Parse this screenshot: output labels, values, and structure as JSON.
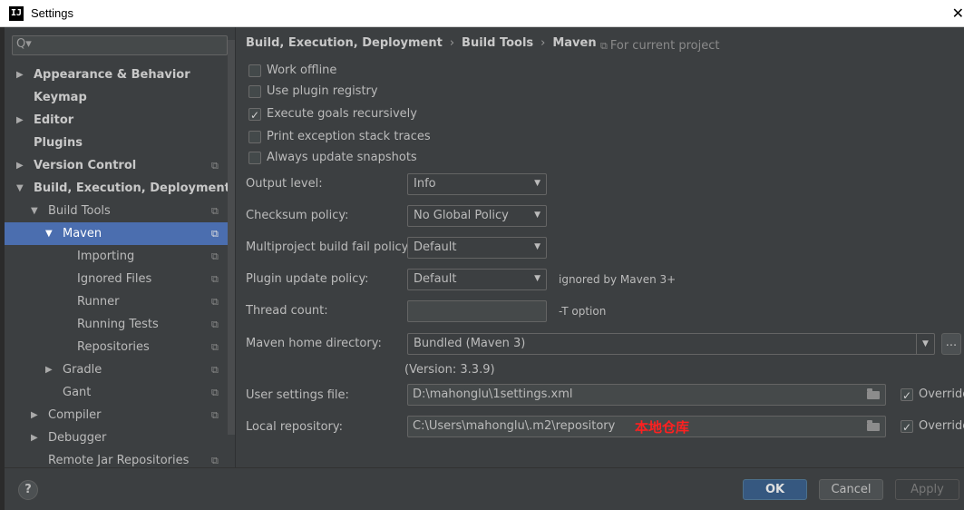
{
  "window": {
    "title": "Settings",
    "close_glyph": "✕",
    "app_icon_text": "IJ"
  },
  "search": {
    "icon": "Q▾",
    "placeholder": ""
  },
  "tree": [
    {
      "label": "Appearance & Behavior",
      "arrow": "▶",
      "bold": true,
      "project": false,
      "selected": false
    },
    {
      "label": "Keymap",
      "arrow": "",
      "bold": true,
      "project": false,
      "selected": false
    },
    {
      "label": "Editor",
      "arrow": "▶",
      "bold": true,
      "project": false,
      "selected": false
    },
    {
      "label": "Plugins",
      "arrow": "",
      "bold": true,
      "project": false,
      "selected": false
    },
    {
      "label": "Version Control",
      "arrow": "▶",
      "bold": true,
      "project": true,
      "selected": false
    },
    {
      "label": "Build, Execution, Deployment",
      "arrow": "▼",
      "bold": true,
      "project": false,
      "selected": false
    },
    {
      "label": "Build Tools",
      "arrow": "▼",
      "bold": false,
      "project": true,
      "selected": false
    },
    {
      "label": "Maven",
      "arrow": "▼",
      "bold": false,
      "project": true,
      "selected": true
    },
    {
      "label": "Importing",
      "arrow": "",
      "bold": false,
      "project": true,
      "selected": false
    },
    {
      "label": "Ignored Files",
      "arrow": "",
      "bold": false,
      "project": true,
      "selected": false
    },
    {
      "label": "Runner",
      "arrow": "",
      "bold": false,
      "project": true,
      "selected": false
    },
    {
      "label": "Running Tests",
      "arrow": "",
      "bold": false,
      "project": true,
      "selected": false
    },
    {
      "label": "Repositories",
      "arrow": "",
      "bold": false,
      "project": true,
      "selected": false
    },
    {
      "label": "Gradle",
      "arrow": "▶",
      "bold": false,
      "project": true,
      "selected": false
    },
    {
      "label": "Gant",
      "arrow": "",
      "bold": false,
      "project": true,
      "selected": false
    },
    {
      "label": "Compiler",
      "arrow": "▶",
      "bold": false,
      "project": true,
      "selected": false
    },
    {
      "label": "Debugger",
      "arrow": "▶",
      "bold": false,
      "project": false,
      "selected": false
    },
    {
      "label": "Remote Jar Repositories",
      "arrow": "",
      "bold": false,
      "project": true,
      "selected": false
    }
  ],
  "project_icon": "⧉",
  "breadcrumb": {
    "part1": "Build, Execution, Deployment",
    "part2": "Build Tools",
    "part3": "Maven",
    "separator": "›"
  },
  "for_project": {
    "icon": "⧉",
    "label": "For current project"
  },
  "checkboxes": [
    {
      "label": "Work offline",
      "checked": false
    },
    {
      "label": "Use plugin registry",
      "checked": false
    },
    {
      "label": "Execute goals recursively",
      "checked": true
    },
    {
      "label": "Print exception stack traces",
      "checked": false
    },
    {
      "label": "Always update snapshots",
      "checked": false
    }
  ],
  "form": {
    "output_level": {
      "label": "Output level:",
      "value": "Info"
    },
    "checksum_policy": {
      "label": "Checksum policy:",
      "value": "No Global Policy"
    },
    "multiproject_fail": {
      "label": "Multiproject build fail policy:",
      "value": "Default"
    },
    "plugin_update": {
      "label": "Plugin update policy:",
      "value": "Default",
      "hint": "ignored by Maven 3+"
    },
    "thread_count": {
      "label": "Thread count:",
      "value": "",
      "hint": "-T option"
    },
    "maven_home": {
      "label": "Maven home directory:",
      "value": "Bundled (Maven 3)",
      "more": "..."
    },
    "version": "(Version: 3.3.9)",
    "user_settings": {
      "label": "User settings file:",
      "value": "D:\\mahonglu\\1settings.xml",
      "override": "Override",
      "override_checked": true
    },
    "local_repo": {
      "label": "Local repository:",
      "value": "C:\\Users\\mahonglu\\.m2\\repository",
      "override": "Override",
      "override_checked": true,
      "annotation": "本地仓库"
    }
  },
  "dropdown_glyph": "▼",
  "footer": {
    "help": "?",
    "ok": "OK",
    "cancel": "Cancel",
    "apply": "Apply"
  },
  "colors": {
    "accent": "#4b6eaf",
    "background": "#3c3f41",
    "ok_button": "#365880",
    "annotation": "#ff2020"
  }
}
